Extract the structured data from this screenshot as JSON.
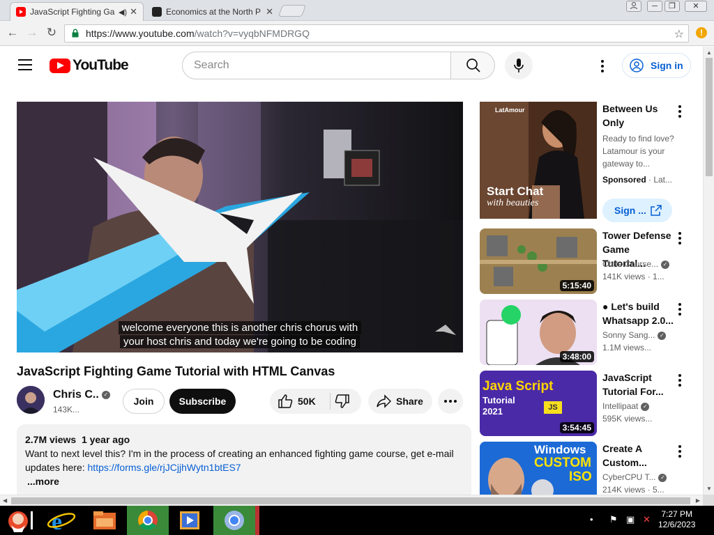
{
  "browser": {
    "tabs": [
      {
        "title": "JavaScript Fighting Ga",
        "active": true
      },
      {
        "title": "Economics at the North P",
        "active": false
      }
    ],
    "url_host": "https://www.youtube.com",
    "url_path": "/watch?v=vyqbNFMDRGQ"
  },
  "header": {
    "logo_text": "YouTube",
    "search_placeholder": "Search",
    "signin_label": "Sign in"
  },
  "video": {
    "caption_line1": "welcome everyone this is another chris chorus with",
    "caption_line2": "your host chris and today we're going to be coding",
    "title": "JavaScript Fighting Game Tutorial with HTML Canvas",
    "channel": "Chris C..",
    "subscribers": "143K...",
    "join_label": "Join",
    "subscribe_label": "Subscribe",
    "likes": "50K",
    "share_label": "Share",
    "description": {
      "views": "2.7M views",
      "age": "1 year ago",
      "text": "Want to next level this? I'm in the process of creating an enhanced fighting game course, get e-mail updates here: ",
      "link": "https://forms.gle/rjJCjjhWytn1btES7",
      "more": "...more"
    }
  },
  "sidebar": {
    "ad": {
      "brand": "LatAmour",
      "overlay_line1": "Start Chat",
      "overlay_line2": "with beauties",
      "title": "Between Us Only",
      "text": "Ready to find love? Latamour is your gateway to...",
      "sponsored_label": "Sponsored",
      "sponsored_rest": " · Lat...",
      "button_label": "Sign ..."
    },
    "items": [
      {
        "title": "Tower Defense Game Tutorial...",
        "channel": "Chris Course...",
        "views": "141K views · 1...",
        "duration": "5:15:40"
      },
      {
        "title": "● Let's build Whatsapp 2.0...",
        "channel": "Sonny Sang...",
        "views": "1.1M views...",
        "duration": "3:48:00"
      },
      {
        "title": "JavaScript Tutorial For...",
        "channel": "Intellipaat",
        "views": "595K views...",
        "duration": "3:54:45",
        "thumb_line1": "Java Script",
        "thumb_line2": "Tutorial",
        "thumb_line3": "2021",
        "thumb_badge": "JS"
      },
      {
        "title": "Create A Custom...",
        "channel": "CyberCPU T...",
        "views": "214K views · 5...",
        "thumb_line1": "Windows",
        "thumb_line2": "CUSTOM",
        "thumb_line3": "ISO"
      }
    ]
  },
  "taskbar": {
    "time": "7:27 PM",
    "date": "12/6/2023"
  }
}
